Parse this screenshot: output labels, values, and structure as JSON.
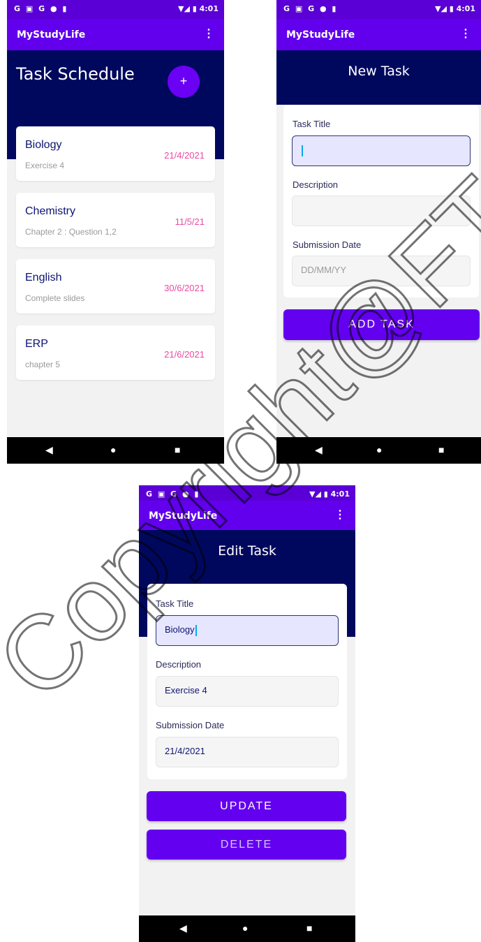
{
  "status": {
    "icons": "G ▣ G ● ▮",
    "right": "▼◢ ▮ 4:01"
  },
  "app": {
    "name": "MyStudyLife",
    "menu_icon": "more-vert-icon"
  },
  "nav": {
    "back": "◀",
    "home": "●",
    "recent": "■"
  },
  "schedule": {
    "title": "Task Schedule",
    "add_label": "+",
    "tasks": [
      {
        "subject": "Biology",
        "desc": "Exercise 4",
        "date": "21/4/2021"
      },
      {
        "subject": "Chemistry",
        "desc": "Chapter 2 : Question 1,2",
        "date": "11/5/21"
      },
      {
        "subject": "English",
        "desc": "Complete slides",
        "date": "30/6/2021"
      },
      {
        "subject": "ERP",
        "desc": "chapter 5",
        "date": "21/6/2021"
      }
    ]
  },
  "new_task": {
    "title": "New Task",
    "labels": {
      "title": "Task Title",
      "desc": "Description",
      "date": "Submission Date"
    },
    "values": {
      "title": "",
      "desc": "",
      "date": ""
    },
    "placeholders": {
      "date": "DD/MM/YY"
    },
    "button": "ADD TASK"
  },
  "edit_task": {
    "title": "Edit Task",
    "labels": {
      "title": "Task Title",
      "desc": "Description",
      "date": "Submission Date"
    },
    "values": {
      "title": "Biology",
      "desc": "Exercise 4",
      "date": "21/4/2021"
    },
    "update": "UPDATE",
    "delete": "DELETE"
  },
  "watermark": {
    "text": "Copyright@FTSM UKM"
  },
  "colors": {
    "appbar": "#6200ee",
    "header": "#00085e",
    "accent": "#6400f0",
    "date": "#e84ba0"
  }
}
